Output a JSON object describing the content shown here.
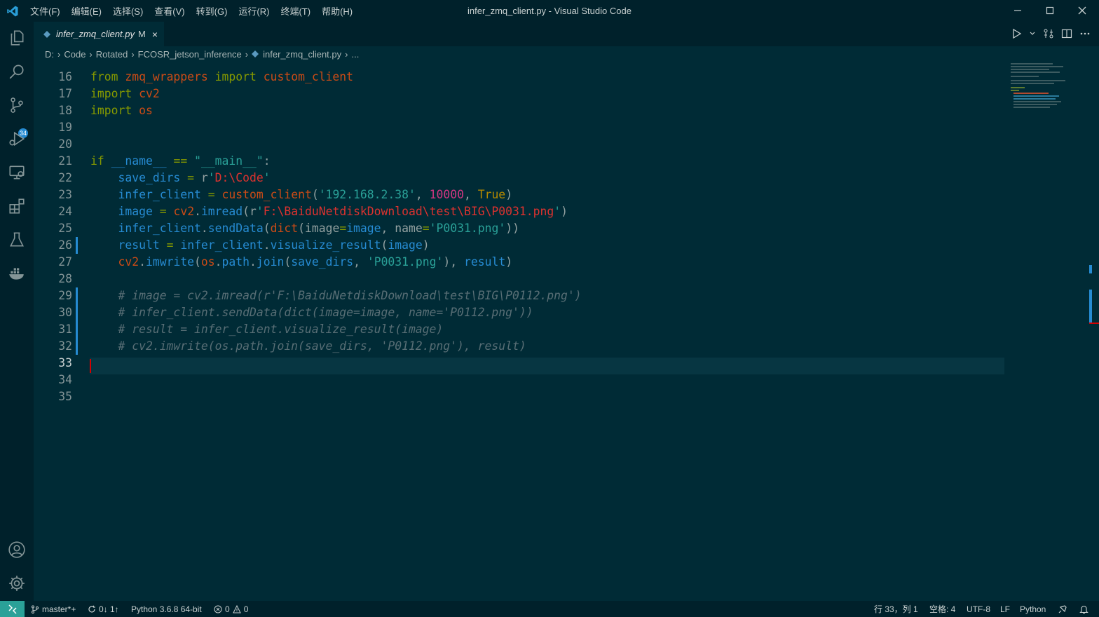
{
  "window": {
    "title": "infer_zmq_client.py - Visual Studio Code",
    "menu": [
      "文件(F)",
      "编辑(E)",
      "选择(S)",
      "查看(V)",
      "转到(G)",
      "运行(R)",
      "终端(T)",
      "帮助(H)"
    ]
  },
  "activity": {
    "scm_badge": "34"
  },
  "tab": {
    "filename": "infer_zmq_client.py",
    "status": "M",
    "close": "×"
  },
  "breadcrumb": [
    "D:",
    "Code",
    "Rotated",
    "FCOSR_jetson_inference",
    "infer_zmq_client.py",
    "..."
  ],
  "editor": {
    "active_line": 33,
    "lines": [
      {
        "n": "16"
      },
      {
        "n": "17"
      },
      {
        "n": "18"
      },
      {
        "n": "19"
      },
      {
        "n": "20"
      },
      {
        "n": "21"
      },
      {
        "n": "22"
      },
      {
        "n": "23"
      },
      {
        "n": "24"
      },
      {
        "n": "25"
      },
      {
        "n": "26"
      },
      {
        "n": "27"
      },
      {
        "n": "28"
      },
      {
        "n": "29"
      },
      {
        "n": "30"
      },
      {
        "n": "31"
      },
      {
        "n": "32"
      },
      {
        "n": "33"
      },
      {
        "n": "34"
      },
      {
        "n": "35"
      }
    ],
    "code": {
      "l16": [
        "from",
        "zmq_wrappers",
        "import",
        "custom_client"
      ],
      "l17": [
        "import",
        "cv2"
      ],
      "l18": [
        "import",
        "os"
      ],
      "l21": [
        "if",
        "__name__",
        "==",
        "\"__main__\"",
        ":"
      ],
      "l22": [
        "save_dirs",
        "=",
        "r",
        "'",
        "D:\\Code",
        "'"
      ],
      "l23": [
        "infer_client",
        "=",
        "custom_client",
        "(",
        "'192.168.2.38'",
        ", ",
        "10000",
        ", ",
        "True",
        ")"
      ],
      "l24": [
        "image",
        "=",
        "cv2",
        ".",
        "imread",
        "(r",
        "'",
        "F:\\BaiduNetdiskDownload\\test\\BIG\\P0031.png",
        "'",
        ")"
      ],
      "l25": [
        "infer_client",
        ".",
        "sendData",
        "(",
        "dict",
        "(",
        "image",
        "=",
        "image",
        ", ",
        "name",
        "=",
        "'P0031.png'",
        "))"
      ],
      "l26": [
        "result",
        "=",
        "infer_client",
        ".",
        "visualize_result",
        "(",
        "image",
        ")"
      ],
      "l27": [
        "cv2",
        ".",
        "imwrite",
        "(",
        "os",
        ".",
        "path",
        ".",
        "join",
        "(",
        "save_dirs",
        ", ",
        "'P0031.png'",
        "), ",
        "result",
        ")"
      ],
      "l29": "# image = cv2.imread(r'F:\\BaiduNetdiskDownload\\test\\BIG\\P0112.png')",
      "l30": "# infer_client.sendData(dict(image=image, name='P0112.png'))",
      "l31": "# result = infer_client.visualize_result(image)",
      "l32": "# cv2.imwrite(os.path.join(save_dirs, 'P0112.png'), result)"
    }
  },
  "statusbar": {
    "branch": "master*+",
    "sync": "0↓ 1↑",
    "interpreter": "Python 3.6.8 64-bit",
    "errors": "0",
    "warnings": "0",
    "position": "行 33，列 1",
    "spaces": "空格: 4",
    "encoding": "UTF-8",
    "eol": "LF",
    "language": "Python"
  },
  "colors": {
    "background": "#002b36",
    "chrome": "#00212b",
    "accent": "#2aa198",
    "keyword": "#859900",
    "string": "#2aa198",
    "variable": "#268bd2",
    "constant": "#d33682"
  }
}
